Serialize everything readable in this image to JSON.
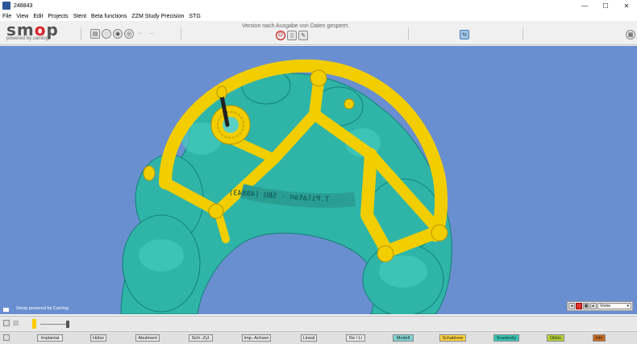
{
  "window": {
    "title": "248843",
    "min": "—",
    "max": "☐",
    "close": "✕"
  },
  "menu": [
    "File",
    "View",
    "Edit",
    "Projects",
    "Stent",
    "Beta functions",
    "ZZM Study Precision",
    "STG"
  ],
  "logo": {
    "brand_pre": "sm",
    "brand_o": "o",
    "brand_post": "p",
    "sub": "powered by camlog"
  },
  "toolbar": {
    "lock_message": "Version nach Ausgabe von Daten gesperrt."
  },
  "viewport": {
    "footnote": "Smop powered by Camlog",
    "view_select": "Vorne",
    "model_label": "T.Pilatan - SBU (48843)"
  },
  "layers": [
    {
      "label": "Implantat",
      "color": "#e8e8e8"
    },
    {
      "label": "Hülse",
      "color": "#e8e8e8"
    },
    {
      "label": "Abutment",
      "color": "#e8e8e8"
    },
    {
      "label": "Sich.-Zyl.",
      "color": "#e8e8e8"
    },
    {
      "label": "Imp.-Achsen",
      "color": "#e8e8e8"
    },
    {
      "label": "Lineal",
      "color": "#e8e8e8"
    },
    {
      "label": "Re / Li",
      "color": "#e8e8e8"
    },
    {
      "label": "Modell",
      "color": "#7fd3d0"
    },
    {
      "label": "Schablone",
      "color": "#ffd23c"
    },
    {
      "label": "Scanbody",
      "color": "#34c7b8"
    },
    {
      "label": "Okklu",
      "color": "#b5d334"
    },
    {
      "label": "Info",
      "color": "#c96a1e"
    }
  ],
  "colors": {
    "viewport_bg": "#6a8fd0",
    "model": "#2fb5a8",
    "template": "#ffd21a"
  }
}
